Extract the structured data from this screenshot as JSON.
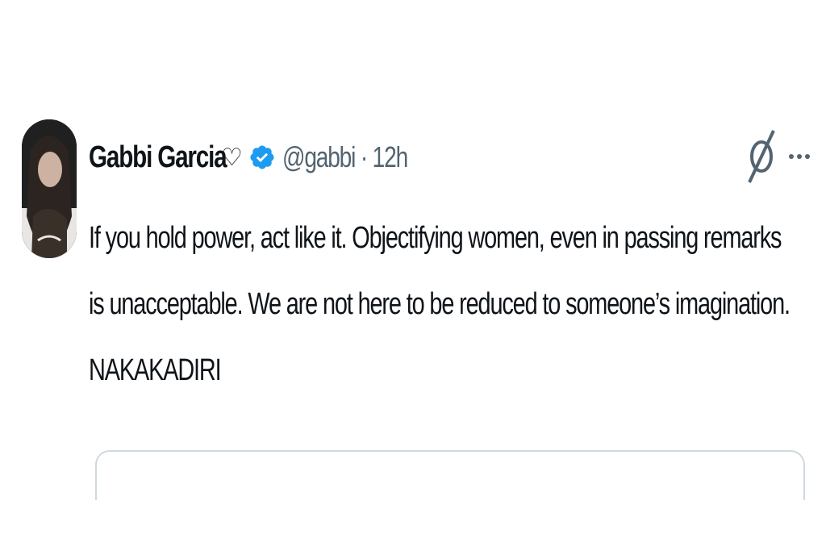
{
  "tweet": {
    "display_name": "Gabbi Garcia",
    "name_emoji": "♡",
    "handle": "@gabbi",
    "separator": "·",
    "time": "12h",
    "lines": [
      "If you hold power, act like it. Objectifying women, even in passing remarks",
      "is unacceptable. We are not here to be reduced to someone’s imagination.",
      "NAKAKADIRI"
    ]
  },
  "icons": {
    "verified": "verified-badge-icon",
    "grok": "grok-icon",
    "more": "more-options-icon",
    "avatar": "avatar"
  },
  "colors": {
    "verified_blue": "#1d9bf0",
    "text": "#0f1419",
    "secondary_text": "#536471",
    "border": "#cfd9de"
  }
}
